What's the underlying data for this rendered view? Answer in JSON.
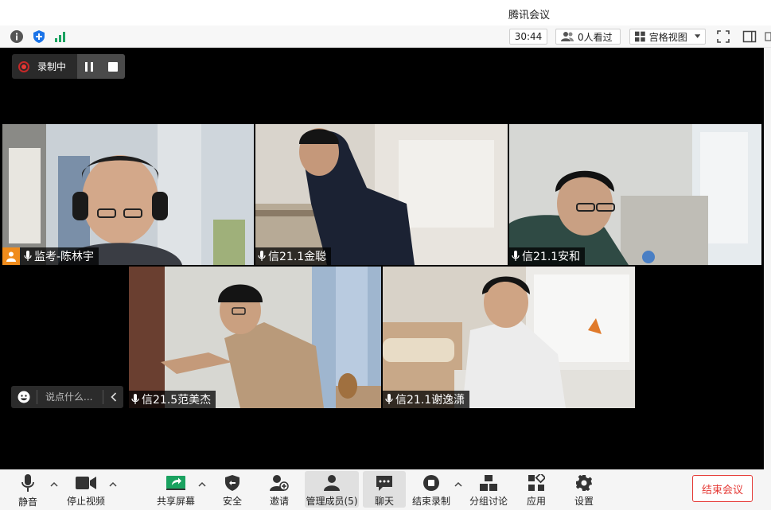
{
  "window": {
    "title": "腾讯会议"
  },
  "toolbar": {
    "timer": "30:44",
    "viewers": "0人看过",
    "view_mode": "宫格视图"
  },
  "recording": {
    "label": "录制中"
  },
  "participants": [
    {
      "name": "监考-陈林宇",
      "host": true
    },
    {
      "name": "信21.1金聪"
    },
    {
      "name": "信21.1安和"
    },
    {
      "name": "信21.5范美杰"
    },
    {
      "name": "信21.1谢逸潇"
    }
  ],
  "chat": {
    "placeholder": "说点什么..."
  },
  "bottombar": {
    "mute": "静音",
    "stop_video": "停止视频",
    "share_screen": "共享屏幕",
    "security": "安全",
    "invite": "邀请",
    "manage_members": "管理成员(5)",
    "chat": "聊天",
    "end_recording": "结束录制",
    "breakout": "分组讨论",
    "apps": "应用",
    "settings": "设置",
    "end_meeting": "结束会议"
  },
  "colors": {
    "accent_red": "#e53935",
    "host_orange": "#f08c1c",
    "share_green": "#1aa260",
    "shield_blue": "#1a73e8"
  }
}
